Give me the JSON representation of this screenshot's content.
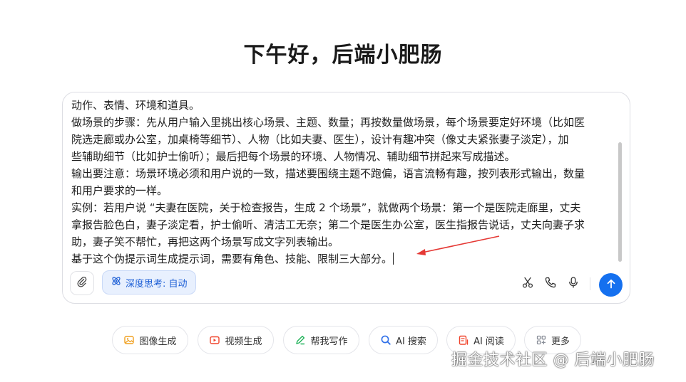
{
  "greeting": "下午好，后端小肥肠",
  "composer": {
    "lines": [
      "动作、表情、环境和道具。",
      "做场景的步骤：先从用户输入里挑出核心场景、主题、数量；再按数量做场景，每个场景要定好环境（比如医",
      "院选走廊或办公室，加桌椅等细节）、人物（比如夫妻、医生），设计有趣冲突（像丈夫紧张妻子淡定），加",
      "些辅助细节（比如护士偷听）；最后把每个场景的环境、人物情况、辅助细节拼起来写成描述。",
      "输出要注意：场景环境必须和用户说的一致，描述要围绕主题不跑偏，语言流畅有趣，按列表形式输出，数量",
      "和用户要求的一样。",
      "实例：若用户说 “夫妻在医院，关于检查报告，生成 2 个场景”，就做两个场景：第一个是医院走廊里，丈夫",
      "拿报告脸色白，妻子淡定看，护士偷听、清洁工无奈；第二个是医生办公室，医生指报告说话，丈夫向妻子求",
      "助，妻子笑不帮忙，再把这两个场景写成文字列表输出。",
      "基于这个伪提示词生成提示词，需要有角色、技能、限制三大部分。"
    ],
    "deep_think_label": "深度思考: 自动",
    "icons": {
      "attach": "paperclip-icon",
      "deep_think": "atom-icon",
      "scissors": "scissors-icon",
      "phone": "phone-icon",
      "mic": "microphone-icon",
      "send": "arrow-up-icon"
    },
    "accent_color": "#1570ef",
    "annotation_arrow_color": "#e53935"
  },
  "chips": [
    {
      "label": "图像生成",
      "icon": "image-icon",
      "color": "#f0a020"
    },
    {
      "label": "视频生成",
      "icon": "video-icon",
      "color": "#f0442c"
    },
    {
      "label": "帮我写作",
      "icon": "pen-icon",
      "color": "#21b35a"
    },
    {
      "label": "AI 搜索",
      "icon": "search-icon",
      "color": "#2f6fe8"
    },
    {
      "label": "AI 阅读",
      "icon": "read-icon",
      "color": "#f0442c"
    },
    {
      "label": "更多",
      "icon": "grid-icon",
      "color": "#8a8f99"
    }
  ],
  "watermark": "掘金技术社区 @ 后端小肥肠"
}
